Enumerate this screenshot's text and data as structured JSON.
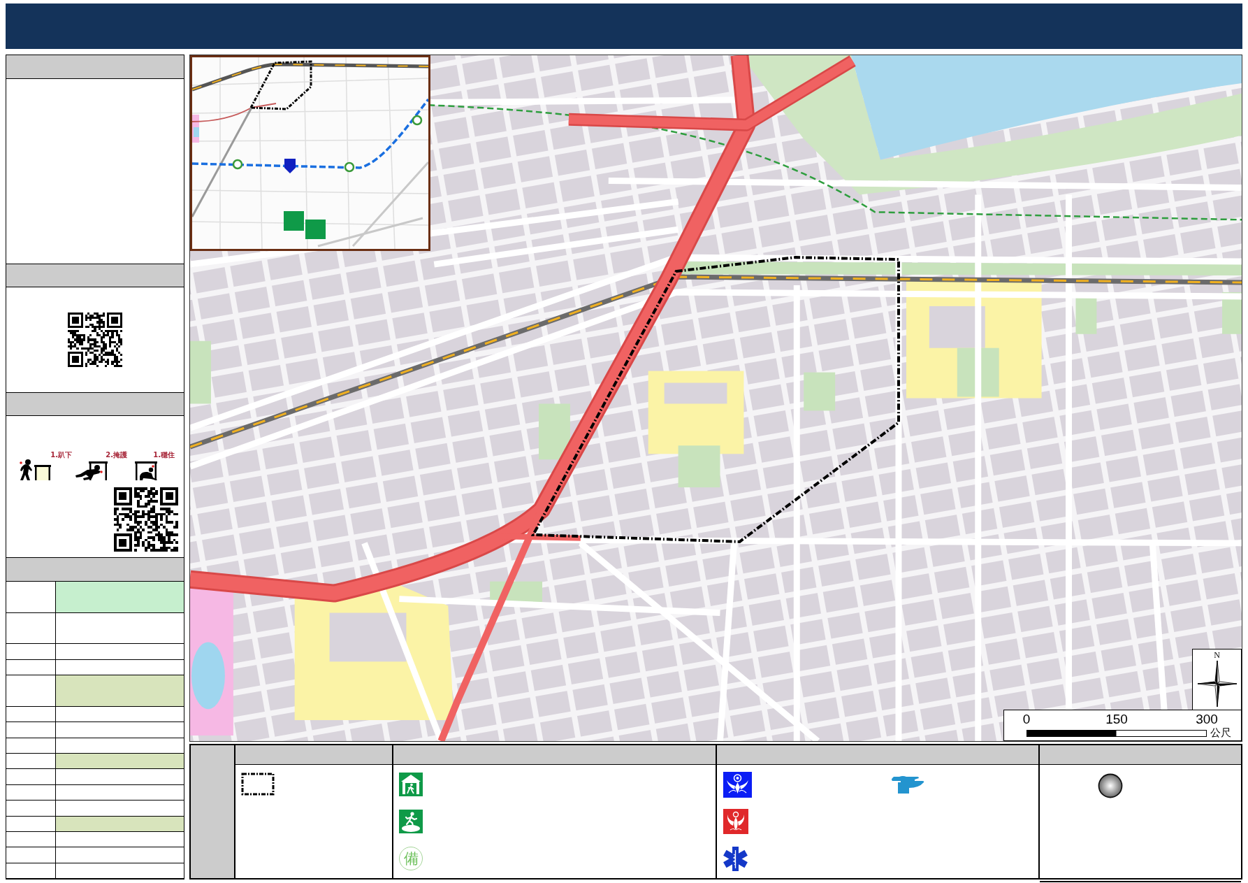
{
  "left_panel": {
    "sections": [
      {
        "kind": "blank"
      },
      {
        "kind": "qr"
      },
      {
        "kind": "drill",
        "steps": [
          "1.趴下",
          "2.掩護",
          "1.穩住"
        ]
      },
      {
        "kind": "table",
        "rows": [
          {
            "kind": "tall",
            "color": "#c6efce"
          },
          {
            "kind": "tall",
            "color": "#ffffff"
          },
          {
            "kind": "short",
            "color": "#ffffff"
          },
          {
            "kind": "short",
            "color": "#ffffff"
          },
          {
            "kind": "tall",
            "color": "#d8e4bc"
          },
          {
            "kind": "short",
            "color": "#ffffff"
          },
          {
            "kind": "short",
            "color": "#ffffff"
          },
          {
            "kind": "short",
            "color": "#ffffff"
          },
          {
            "kind": "short",
            "color": "#d8e4bc"
          },
          {
            "kind": "short",
            "color": "#ffffff"
          },
          {
            "kind": "short",
            "color": "#ffffff"
          },
          {
            "kind": "short",
            "color": "#ffffff"
          },
          {
            "kind": "short",
            "color": "#d8e4bc"
          },
          {
            "kind": "short",
            "color": "#ffffff"
          },
          {
            "kind": "short",
            "color": "#ffffff"
          },
          {
            "kind": "short",
            "color": "#ffffff"
          }
        ]
      }
    ]
  },
  "map": {
    "compass": {
      "north": "N"
    },
    "scale_bar": {
      "ticks": [
        "0",
        "150",
        "300"
      ],
      "unit": "公尺"
    }
  },
  "legend": {
    "columns": [
      {
        "items": [
          {
            "kind": "boundary"
          }
        ],
        "footer": false
      },
      {
        "items": [
          {
            "kind": "shelter"
          },
          {
            "kind": "evacuation"
          },
          {
            "kind": "standby",
            "symbol": "備"
          }
        ],
        "footer": false
      },
      {
        "items": [
          {
            "kind": "police"
          },
          {
            "kind": "fire"
          },
          {
            "kind": "ems"
          },
          {
            "kind": "faucet"
          }
        ],
        "footer": false
      },
      {
        "items": [
          {
            "kind": "sphere"
          }
        ],
        "footer": true
      }
    ]
  }
}
